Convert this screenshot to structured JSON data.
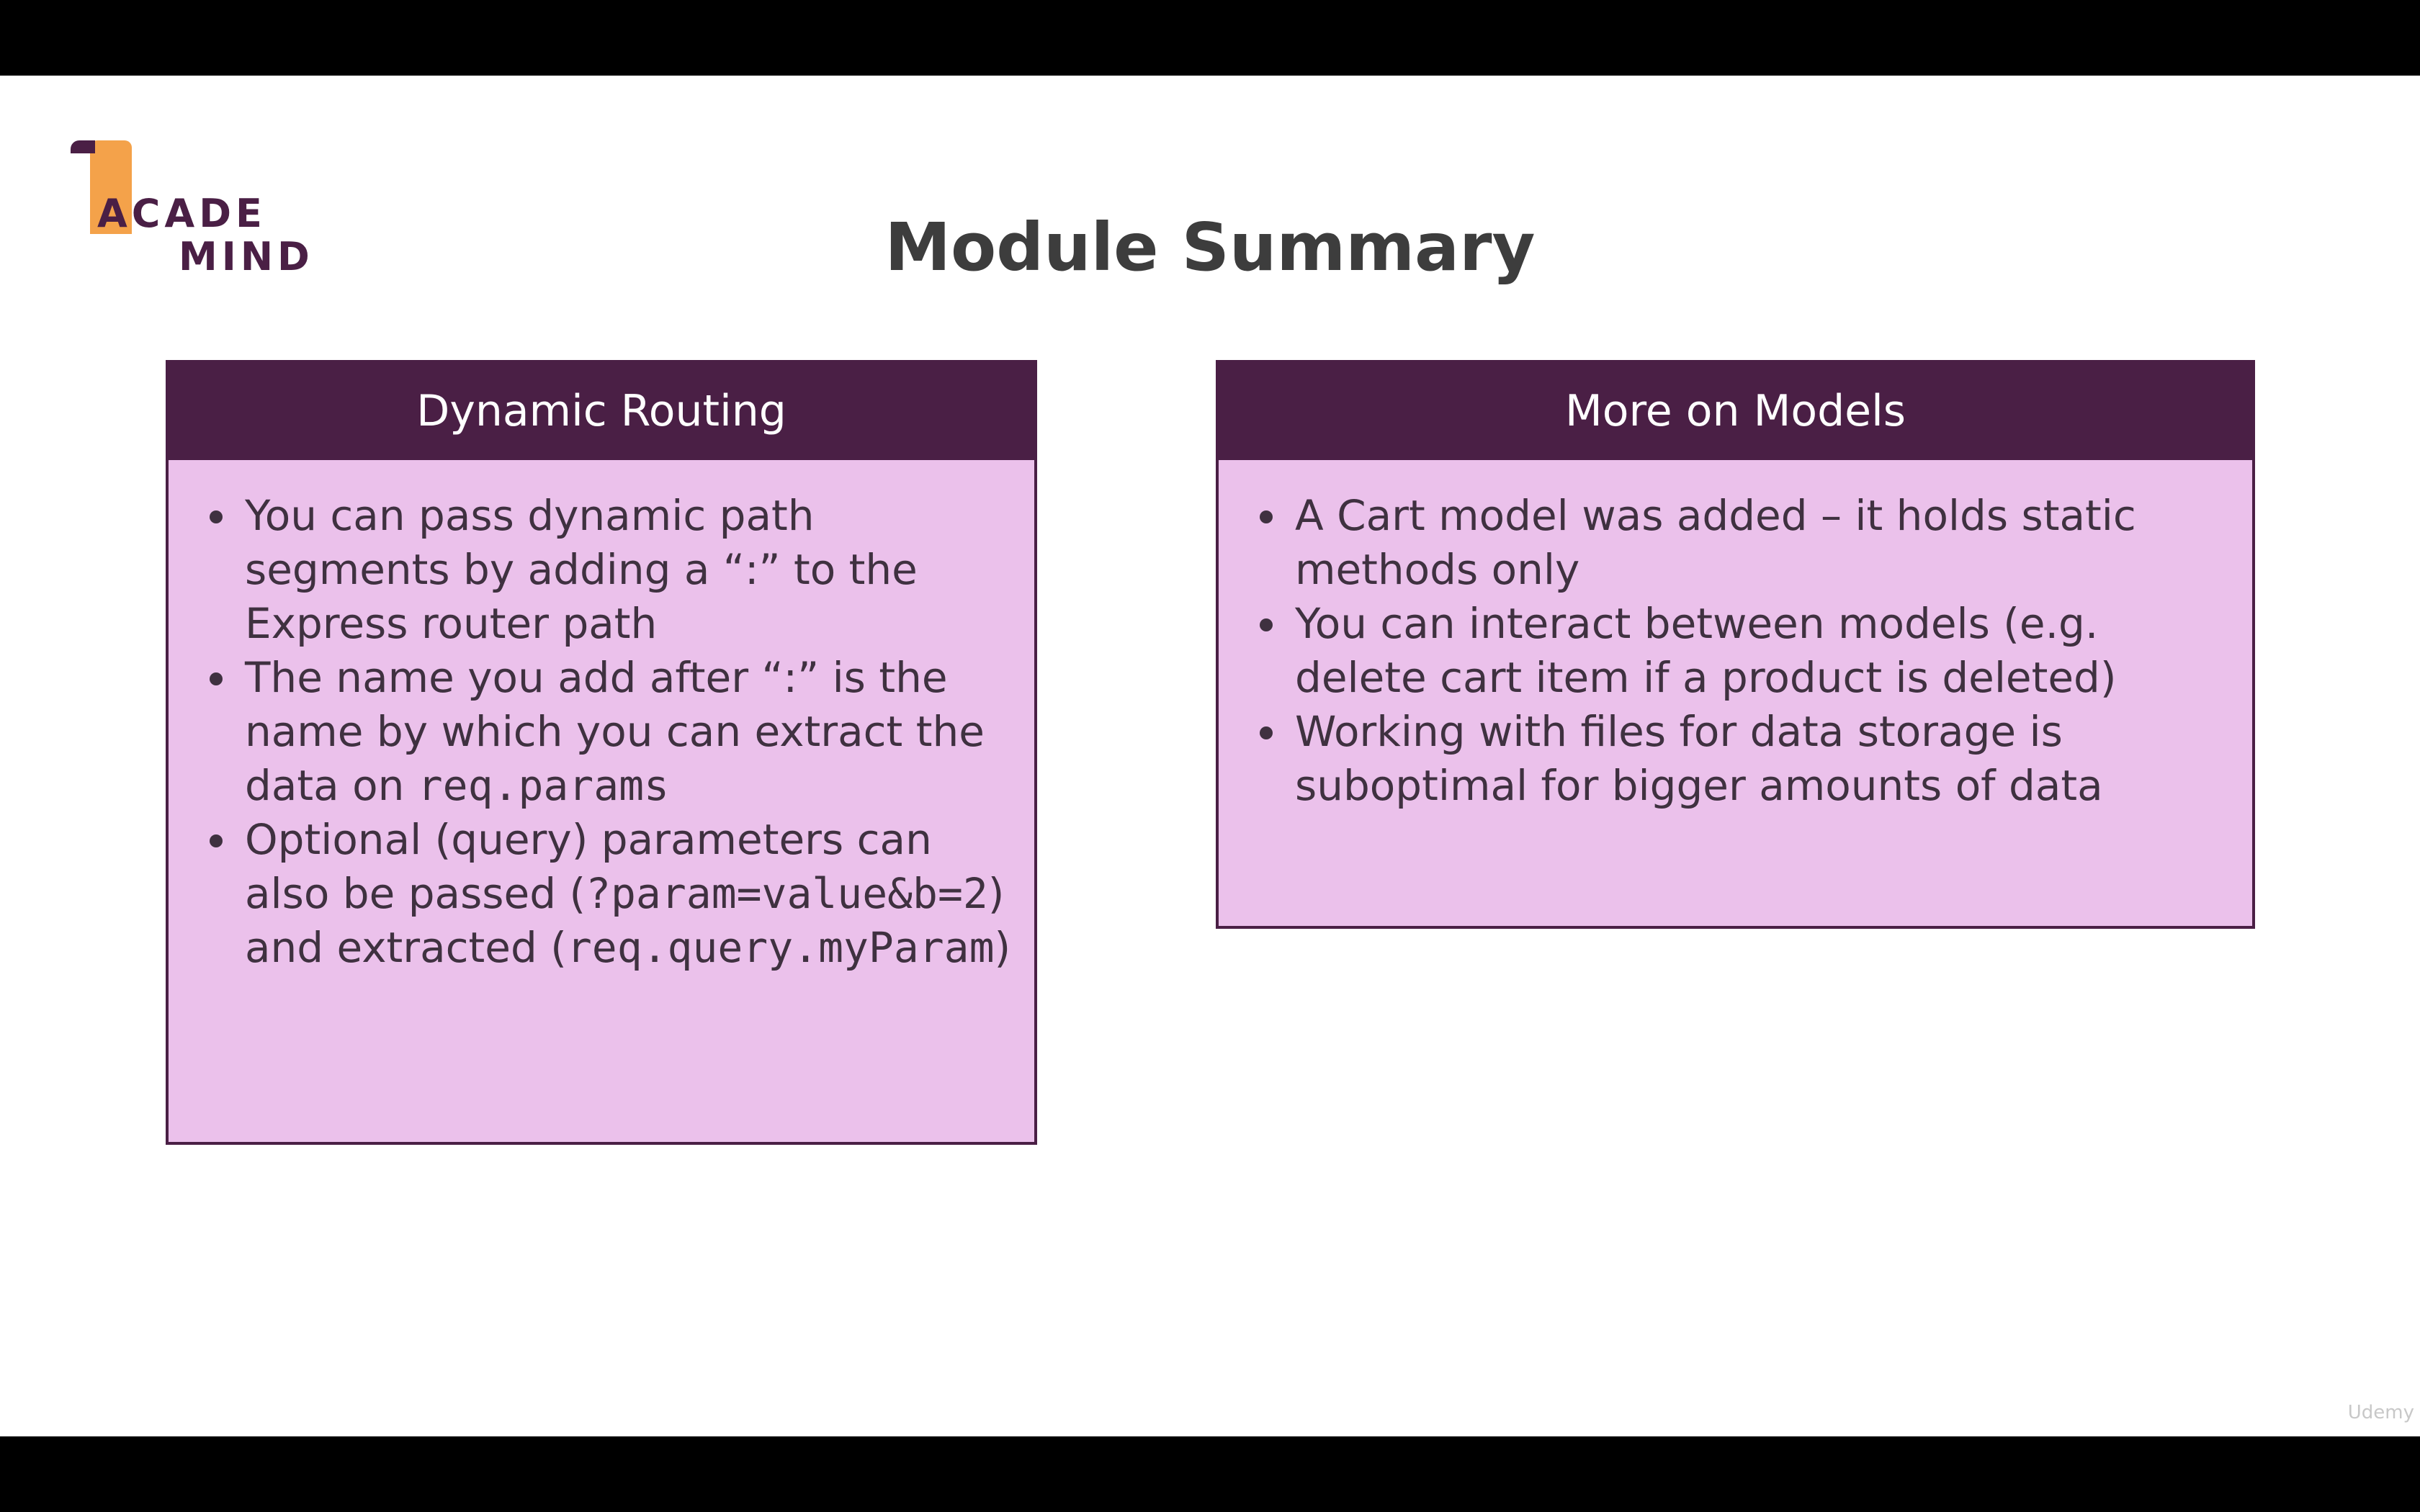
{
  "logo": {
    "line1": "ACADE",
    "line2": "MIND"
  },
  "title": "Module Summary",
  "cards": [
    {
      "header": "Dynamic Routing",
      "items": [
        {
          "parts": [
            "You can pass dynamic path segments by adding a “:” to the Express router path"
          ]
        },
        {
          "parts": [
            "The name you add after “:” is the name by which you can extract the data on ",
            "req.params"
          ]
        },
        {
          "parts": [
            "Optional (query) parameters can also be passed (",
            "?param=value&b=2",
            ") and extracted (",
            "req.query.myParam",
            ")"
          ]
        }
      ]
    },
    {
      "header": "More on Models",
      "items": [
        {
          "parts": [
            "A Cart model was added – it holds static methods only"
          ]
        },
        {
          "parts": [
            "You can interact between models (e.g. delete cart item if a product is deleted)"
          ]
        },
        {
          "parts": [
            "Working with files for data storage is suboptimal for bigger amounts of data"
          ]
        }
      ]
    }
  ],
  "watermark": "Udemy"
}
